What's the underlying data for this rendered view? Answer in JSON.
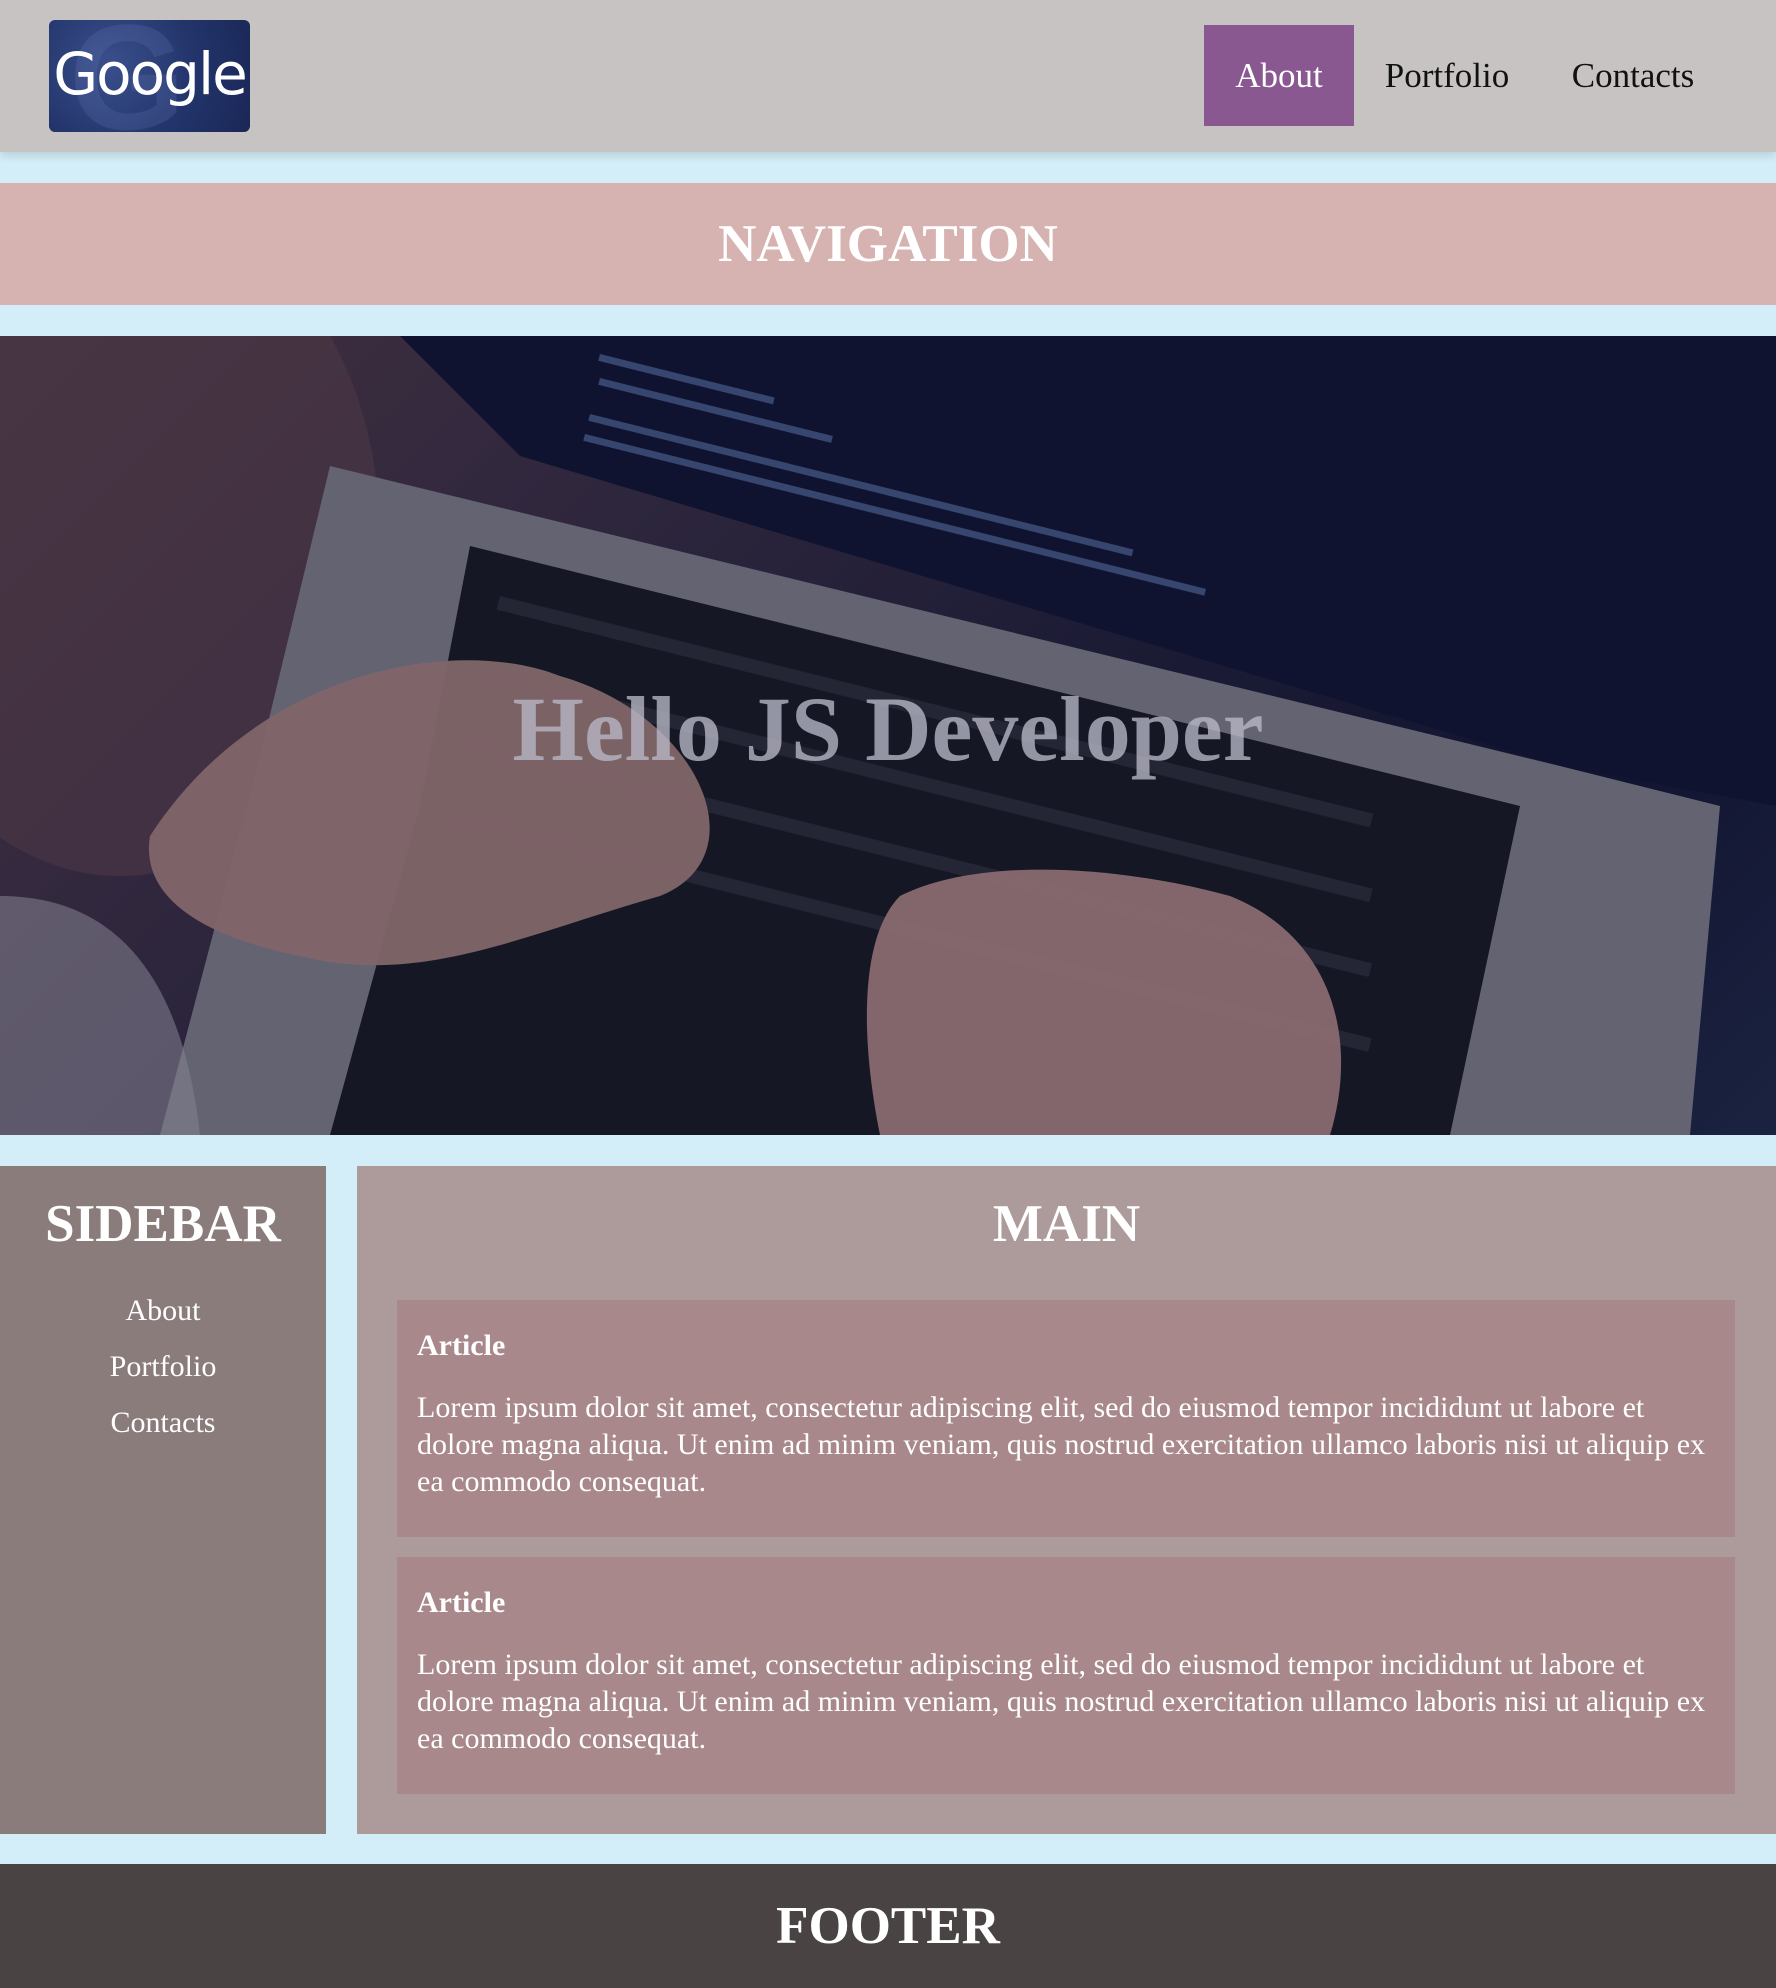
{
  "header": {
    "logo_text": "Google",
    "nav": [
      {
        "label": "About",
        "active": true
      },
      {
        "label": "Portfolio",
        "active": false
      },
      {
        "label": "Contacts",
        "active": false
      }
    ]
  },
  "navigation": {
    "title": "NAVIGATION"
  },
  "hero": {
    "title": "Hello JS Developer"
  },
  "sidebar": {
    "title": "SIDEBAR",
    "items": [
      {
        "label": "About"
      },
      {
        "label": "Portfolio"
      },
      {
        "label": "Contacts"
      }
    ]
  },
  "main": {
    "title": "MAIN",
    "articles": [
      {
        "title": "Article",
        "body": "Lorem ipsum dolor sit amet, consectetur adipiscing elit, sed do eiusmod tempor incididunt ut labore et dolore magna aliqua. Ut enim ad minim veniam, quis nostrud exercitation ullamco laboris nisi ut aliquip ex ea commodo consequat."
      },
      {
        "title": "Article",
        "body": "Lorem ipsum dolor sit amet, consectetur adipiscing elit, sed do eiusmod tempor incididunt ut labore et dolore magna aliqua. Ut enim ad minim veniam, quis nostrud exercitation ullamco laboris nisi ut aliquip ex ea commodo consequat."
      }
    ]
  },
  "footer": {
    "title": "FOOTER"
  },
  "colors": {
    "page_background": "#d3eef8",
    "header": "#c8c3c3",
    "nav_active": "#8a5891",
    "navigation_band": "#d6b2b0",
    "sidebar": "#8b7c7c",
    "main": "#ad9b9b",
    "article": "#a8888a",
    "footer": "#494343"
  }
}
